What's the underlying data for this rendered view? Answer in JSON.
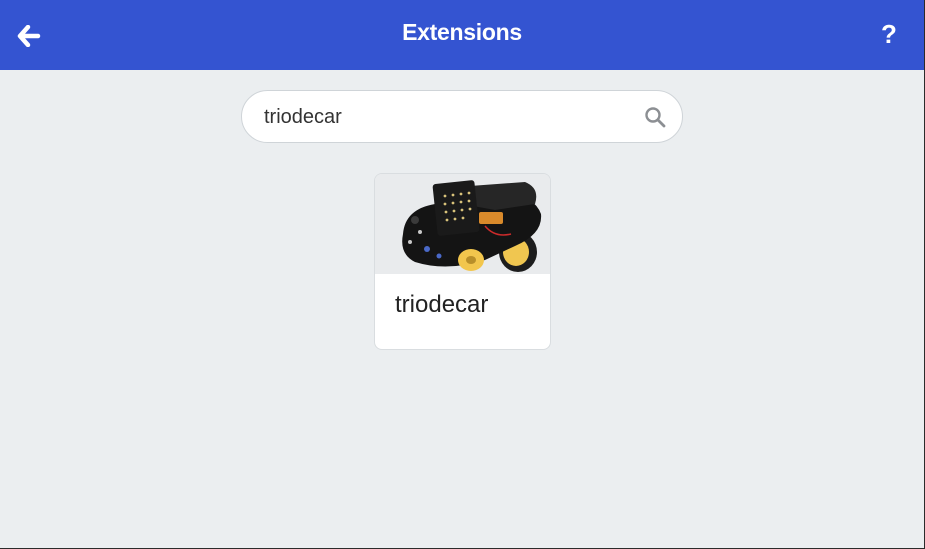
{
  "header": {
    "title": "Extensions",
    "back_icon": "arrow-left-icon",
    "help_label": "?",
    "background": "#3454d1"
  },
  "search": {
    "value": "triodecar",
    "placeholder": "",
    "icon": "search-icon"
  },
  "results": [
    {
      "name": "triodecar",
      "image": "robot-car-photo"
    }
  ]
}
